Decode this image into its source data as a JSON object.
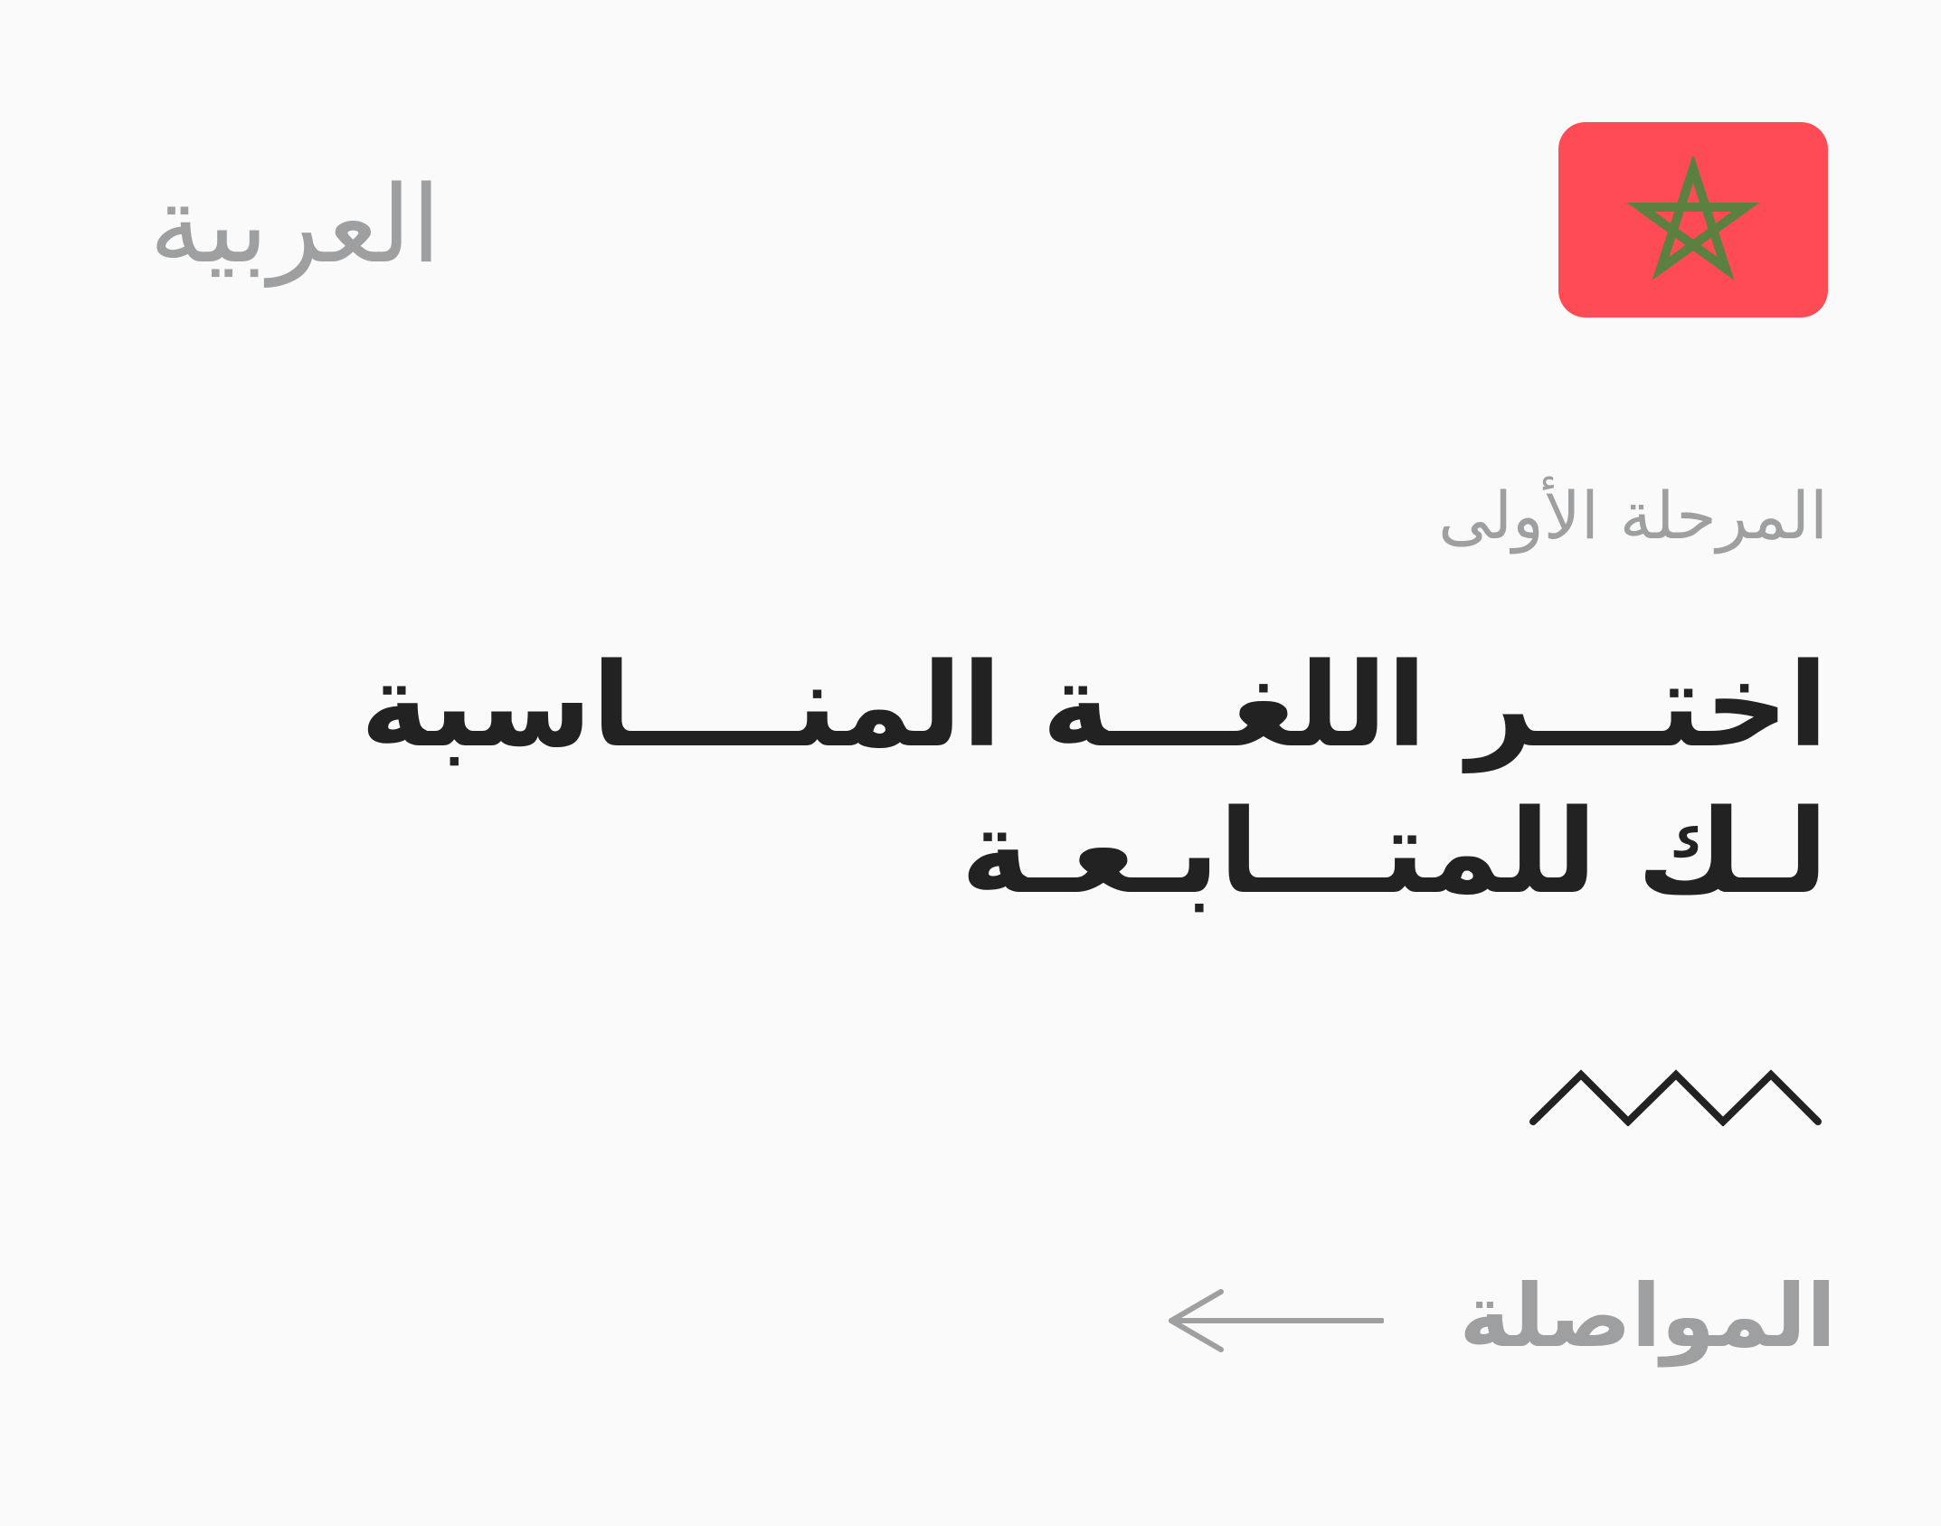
{
  "language": {
    "label": "العربية",
    "flag": "morocco-flag"
  },
  "step": {
    "label": "المرحلة الأولى"
  },
  "headline": {
    "line1": "اختـــر اللغـــة المنــــاسبة",
    "line2": "لـك للمتـــابـعـة"
  },
  "action": {
    "continue_label": "المواصلة",
    "arrow_icon": "arrow-left-icon"
  },
  "decoration": {
    "icon": "zigzag-icon"
  },
  "colors": {
    "background": "#FAFAFA",
    "muted_text": "#9E9FA0",
    "primary_text": "#222222",
    "flag_red": "#FF4B55",
    "flag_star": "#5C8040"
  }
}
